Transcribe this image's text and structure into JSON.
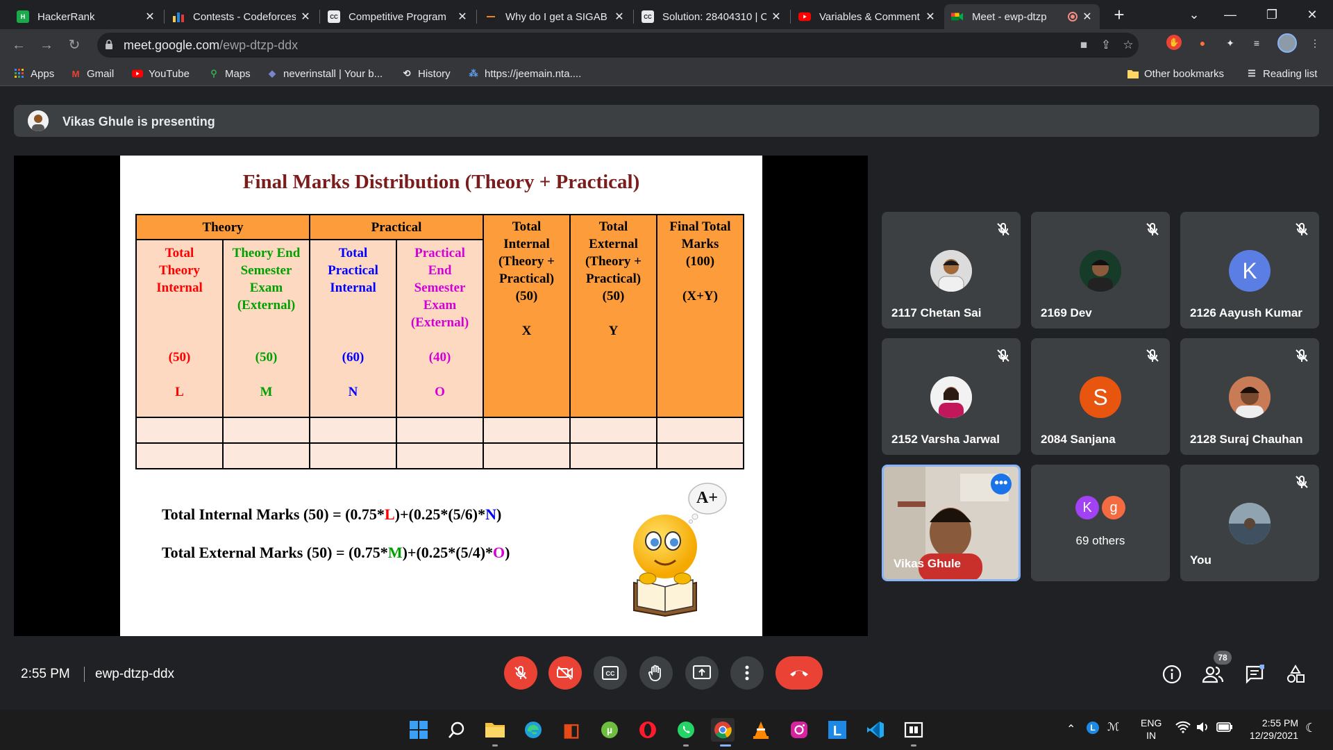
{
  "browser": {
    "tabs": [
      {
        "title": "HackerRank",
        "favicon": "hackerrank-icon"
      },
      {
        "title": "Contests - Codeforces",
        "favicon": "codeforces-icon"
      },
      {
        "title": "Competitive Program",
        "favicon": "codechef-icon"
      },
      {
        "title": "Why do I get a SIGAB",
        "favicon": "stackoverflow-icon"
      },
      {
        "title": "Solution: 28404310 | C",
        "favicon": "codechef-icon"
      },
      {
        "title": "Variables & Comment",
        "favicon": "youtube-icon"
      },
      {
        "title": "Meet - ewp-dtzp",
        "favicon": "meet-icon",
        "active": true
      }
    ],
    "url_host": "meet.google.com",
    "url_path": "/ewp-dtzp-ddx",
    "bookmarks": [
      {
        "label": "Apps",
        "icon": "apps-grid-icon"
      },
      {
        "label": "Gmail",
        "icon": "gmail-icon"
      },
      {
        "label": "YouTube",
        "icon": "youtube-icon"
      },
      {
        "label": "Maps",
        "icon": "maps-icon"
      },
      {
        "label": "neverinstall | Your b...",
        "icon": "neverinstall-icon"
      },
      {
        "label": "History",
        "icon": "history-icon"
      },
      {
        "label": "https://jeemain.nta....",
        "icon": "nta-icon"
      }
    ],
    "other_bookmarks": "Other bookmarks",
    "reading_list": "Reading list"
  },
  "meet": {
    "presenting_banner": "Vikas Ghule is presenting",
    "slide": {
      "title": "Final Marks Distribution (Theory + Practical)",
      "groups": {
        "theory": "Theory",
        "practical": "Practical"
      },
      "columns": [
        {
          "label": "Total Theory Internal",
          "marks": "(50)",
          "symbol": "L"
        },
        {
          "label": "Theory End Semester Exam (External)",
          "marks": "(50)",
          "symbol": "M"
        },
        {
          "label": "Total Practical Internal",
          "marks": "(60)",
          "symbol": "N"
        },
        {
          "label": "Practical End Semester Exam (External)",
          "marks": "(40)",
          "symbol": "O"
        }
      ],
      "totals": [
        {
          "label": "Total Internal (Theory + Practical)",
          "marks": "(50)",
          "symbol": "X"
        },
        {
          "label": "Total External (Theory + Practical)",
          "marks": "(50)",
          "symbol": "Y"
        },
        {
          "label": "Final Total Marks",
          "marks": "(100)",
          "symbol": "(X+Y)"
        }
      ],
      "formula_internal": {
        "prefix": "Total Internal Marks (50) = (0.75*",
        "v1": "L",
        "mid": ")+(0.25*(5/6)*",
        "v2": "N",
        "suffix": ")"
      },
      "formula_external": {
        "prefix": "Total External Marks (50) = (0.75*",
        "v1": "M",
        "mid": ")+(0.25*(5/4)*",
        "v2": "O",
        "suffix": ")"
      },
      "badge_text": "A+"
    },
    "participants": [
      {
        "name": "2117 Chetan Sai",
        "muted": true
      },
      {
        "name": "2169 Dev",
        "muted": true
      },
      {
        "name": "2126 Aayush Kumar",
        "muted": true,
        "initial": "K",
        "color": "#5b7ee5"
      },
      {
        "name": "2152 Varsha Jarwal",
        "muted": true
      },
      {
        "name": "2084 Sanjana",
        "muted": true,
        "initial": "S",
        "color": "#e8550f"
      },
      {
        "name": "2128 Suraj Chauhan",
        "muted": true
      },
      {
        "name": "Vikas Ghule",
        "muted": false
      },
      {
        "name": "69 others",
        "initials": [
          "K",
          "g"
        ],
        "colors": [
          "#a142f4",
          "#f46b42"
        ]
      },
      {
        "name": "You",
        "muted": true
      }
    ],
    "time": "2:55 PM",
    "meeting_code": "ewp-dtzp-ddx",
    "participant_count": "78",
    "controls": [
      "mic-off",
      "camera-off",
      "captions",
      "raise-hand",
      "present",
      "more-options",
      "leave-call"
    ]
  },
  "taskbar": {
    "lang_top": "ENG",
    "lang_bottom": "IN",
    "clock_time": "2:55 PM",
    "clock_date": "12/29/2021"
  },
  "colors": {
    "accent": "#8ab4f8",
    "danger": "#ea4335",
    "slide_orange": "#fd9c3b",
    "slide_peach": "#fdd9c2"
  }
}
